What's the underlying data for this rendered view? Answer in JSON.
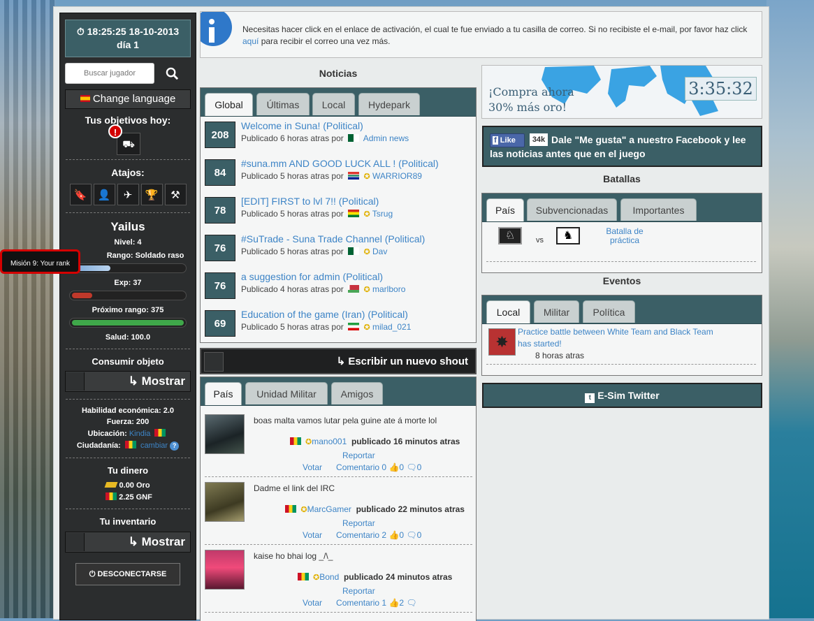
{
  "clock": {
    "datetime": "18:25:25 18-10-2013",
    "day": "día 1"
  },
  "search": {
    "placeholder": "Buscar jugador"
  },
  "language": {
    "label": "Change language"
  },
  "objectives": {
    "title": "Tus objetivos hoy:"
  },
  "shortcuts": {
    "title": "Atajos:",
    "icons": [
      "bookmark-icon",
      "user-add-icon",
      "plane-icon",
      "trophy-icon",
      "tools-icon"
    ]
  },
  "player": {
    "name": "Yailus",
    "level": "Nivel: 4",
    "rank": "Rango: Soldado raso",
    "exp": "Exp:  37",
    "next_rank": "Próximo rango:  375",
    "health": "Salud:  100.0",
    "exp_fraction": 0.2,
    "next_rank_fraction": 0.15,
    "health_fraction": 1.0
  },
  "tooltip": {
    "text": "Misión 9: Your rank"
  },
  "consume": {
    "title": "Consumir objeto",
    "button": "Mostrar"
  },
  "stats": {
    "economic": "Habilidad económica: 2.0",
    "strength": "Fuerza: 200",
    "location_label": "Ubicación:",
    "location": "Kindia",
    "citizenship_label": "Ciudadanía:",
    "change": "cambiar"
  },
  "money": {
    "title": "Tu dinero",
    "gold": "0.00 Oro",
    "gnf": "2.25 GNF"
  },
  "inventory": {
    "title": "Tu inventario",
    "button": "Mostrar"
  },
  "logout": {
    "label": "DESCONECTARSE"
  },
  "info": {
    "text1": "Necesitas hacer click en el enlace de activación, el cual te fue enviado a tu casilla de correo. Si no recibiste el e-mail, por favor haz click",
    "link": "aquí",
    "text2": "para recibir el correo una vez más."
  },
  "news": {
    "title": "Noticias",
    "tabs": [
      "Global",
      "Últimas",
      "Local",
      "Hydepark"
    ],
    "items": [
      {
        "votes": "208",
        "title": "Welcome in Suna! (Political)",
        "published": "Publicado 6 horas atras por",
        "author": "Admin news",
        "flag": "f-dz"
      },
      {
        "votes": "84",
        "title": "#suna.mm AND GOOD LUCK ALL ! (Political)",
        "published": "Publicado 5 horas atras por",
        "author": "WARRIOR89",
        "flag": "f-za"
      },
      {
        "votes": "78",
        "title": "[EDIT] FIRST to lvl 7!! (Political)",
        "published": "Publicado 5 horas atras por",
        "author": "Tsrug",
        "flag": "f-bo"
      },
      {
        "votes": "76",
        "title": "#SuTrade - Suna Trade Channel (Political)",
        "published": "Publicado 5 horas atras por",
        "author": "Dav",
        "flag": "f-dz"
      },
      {
        "votes": "76",
        "title": "a suggestion for admin (Political)",
        "published": "Publicado 4 horas atras por",
        "author": "marlboro",
        "flag": "f-by"
      },
      {
        "votes": "69",
        "title": "Education of the game (Iran) (Political)",
        "published": "Publicado 5 horas atras por",
        "author": "milad_021",
        "flag": "f-ir"
      }
    ]
  },
  "shoutbox": {
    "write": "Escribir un nuevo shout",
    "tabs": [
      "País",
      "Unidad Militar",
      "Amigos"
    ],
    "items": [
      {
        "message": "boas malta vamos lutar pela guine ate á morte lol",
        "author": "mano001",
        "time": "publicado 16 minutos atras",
        "report": "Reportar",
        "vote": "Votar",
        "comment": "Comentario 0",
        "likes": "0",
        "replies": "0"
      },
      {
        "message": "Dadme el link del IRC",
        "author": "MarcGamer",
        "time": "publicado 22 minutos atras",
        "report": "Reportar",
        "vote": "Votar",
        "comment": "Comentario 2",
        "likes": "0",
        "replies": "0"
      },
      {
        "message": "kaise ho bhai log _/\\_",
        "author": "Bond",
        "time": "publicado 24 minutos atras",
        "report": "Reportar",
        "vote": "Votar",
        "comment": "Comentario 1",
        "likes": "2",
        "replies": ""
      }
    ]
  },
  "promo": {
    "line1": "¡Compra ahora",
    "line2": "30% más oro!",
    "timer": "3:35:32"
  },
  "facebook": {
    "like": "Like",
    "count": "34k",
    "text": "Dale \"Me gusta\" a nuestro Facebook y lee las noticias antes que en el juego"
  },
  "battles": {
    "title": "Batallas",
    "tabs": [
      "País",
      "Subvencionadas",
      "Importantes"
    ],
    "vs": "vs",
    "link": "Batalla de práctica"
  },
  "events": {
    "title": "Eventos",
    "tabs": [
      "Local",
      "Militar",
      "Política"
    ],
    "text": "Practice battle between White Team and Black Team has started!",
    "time": "8 horas atras"
  },
  "twitter": {
    "label": "E-Sim Twitter"
  }
}
